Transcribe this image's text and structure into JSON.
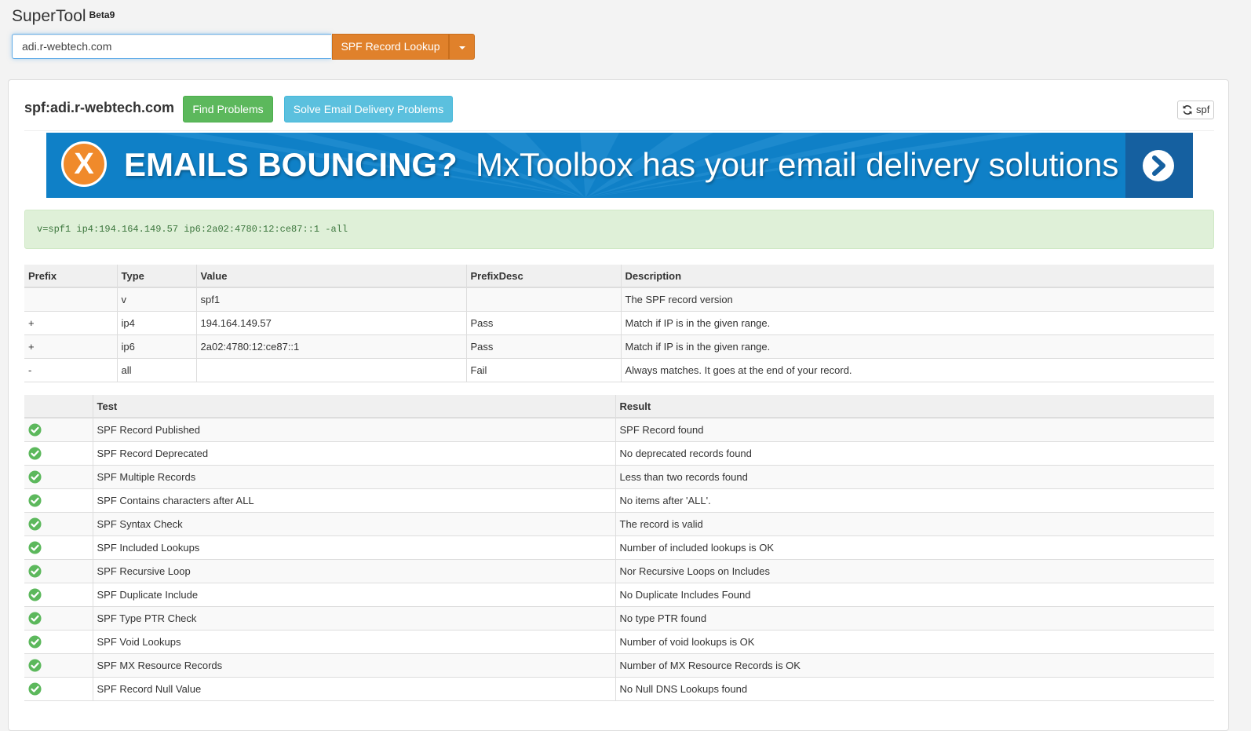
{
  "header": {
    "brand": "SuperTool",
    "beta": "Beta9",
    "search_value": "adi.r-webtech.com",
    "lookup_label": "SPF Record Lookup"
  },
  "result": {
    "title": "spf:adi.r-webtech.com",
    "find_problems_label": "Find Problems",
    "solve_label": "Solve Email Delivery Problems",
    "refresh_label": "spf"
  },
  "banner": {
    "icon_letter": "X",
    "headline": "EMAILS BOUNCING?",
    "tagline": "MxToolbox has your email delivery solutions"
  },
  "spf_record": "v=spf1 ip4:194.164.149.57 ip6:2a02:4780:12:ce87::1 -all",
  "record_table": {
    "headers": [
      "Prefix",
      "Type",
      "Value",
      "PrefixDesc",
      "Description"
    ],
    "rows": [
      [
        "",
        "v",
        "spf1",
        "",
        "The SPF record version"
      ],
      [
        "+",
        "ip4",
        "194.164.149.57",
        "Pass",
        "Match if IP is in the given range."
      ],
      [
        "+",
        "ip6",
        "2a02:4780:12:ce87::1",
        "Pass",
        "Match if IP is in the given range."
      ],
      [
        "-",
        "all",
        "",
        "Fail",
        "Always matches. It goes at the end of your record."
      ]
    ]
  },
  "test_table": {
    "headers": [
      "",
      "Test",
      "Result"
    ],
    "status_color": "#5cb85c",
    "rows": [
      {
        "status": "pass",
        "test": "SPF Record Published",
        "result": "SPF Record found"
      },
      {
        "status": "pass",
        "test": "SPF Record Deprecated",
        "result": "No deprecated records found"
      },
      {
        "status": "pass",
        "test": "SPF Multiple Records",
        "result": "Less than two records found"
      },
      {
        "status": "pass",
        "test": "SPF Contains characters after ALL",
        "result": "No items after 'ALL'."
      },
      {
        "status": "pass",
        "test": "SPF Syntax Check",
        "result": "The record is valid"
      },
      {
        "status": "pass",
        "test": "SPF Included Lookups",
        "result": "Number of included lookups is OK"
      },
      {
        "status": "pass",
        "test": "SPF Recursive Loop",
        "result": "Nor Recursive Loops on Includes"
      },
      {
        "status": "pass",
        "test": "SPF Duplicate Include",
        "result": "No Duplicate Includes Found"
      },
      {
        "status": "pass",
        "test": "SPF Type PTR Check",
        "result": "No type PTR found"
      },
      {
        "status": "pass",
        "test": "SPF Void Lookups",
        "result": "Number of void lookups is OK"
      },
      {
        "status": "pass",
        "test": "SPF MX Resource Records",
        "result": "Number of MX Resource Records is OK"
      },
      {
        "status": "pass",
        "test": "SPF Record Null Value",
        "result": "No Null DNS Lookups found"
      }
    ]
  }
}
